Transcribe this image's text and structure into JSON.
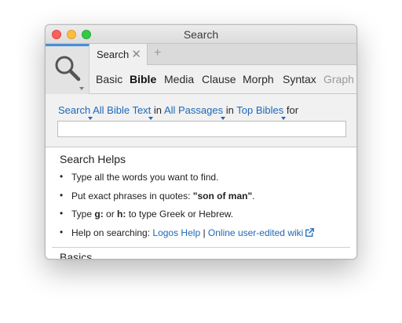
{
  "window": {
    "title": "Search"
  },
  "tabs": [
    {
      "label": "Search"
    }
  ],
  "search_types": {
    "basic": "Basic",
    "bible": "Bible",
    "media": "Media",
    "clause": "Clause",
    "morph": "Morph",
    "syntax": "Syntax",
    "graph": "Graph"
  },
  "query": {
    "search_label": "Search",
    "scope": "All Bible Text",
    "in1": "in",
    "passages": "All Passages",
    "in2": "in",
    "bibles": "Top Bibles",
    "for": "for",
    "value": "",
    "placeholder": ""
  },
  "helps": {
    "title": "Search Helps",
    "item1": "Type all the words you want to find.",
    "item2_prefix": "Put exact phrases in quotes: ",
    "item2_bold": "\"son of man\"",
    "item2_suffix": ".",
    "item3_prefix": "Type ",
    "item3_g": "g:",
    "item3_mid": " or ",
    "item3_h": "h:",
    "item3_suffix": " to type Greek or Hebrew.",
    "item4_prefix": "Help on searching: ",
    "item4_link1": "Logos Help",
    "item4_sep": " | ",
    "item4_link2": "Online user-edited wiki"
  },
  "basics": {
    "title": "Basics"
  },
  "colors": {
    "link": "#1d68b9",
    "active_tab_accent": "#4a8fd6",
    "close": "#fc605b",
    "minimize": "#fdbc40",
    "maximize": "#34c84a"
  },
  "icons": {
    "search_tool": "magnifier-icon",
    "tab_close": "close-icon",
    "new_tab": "plus-icon",
    "external_link": "external-link-icon"
  }
}
